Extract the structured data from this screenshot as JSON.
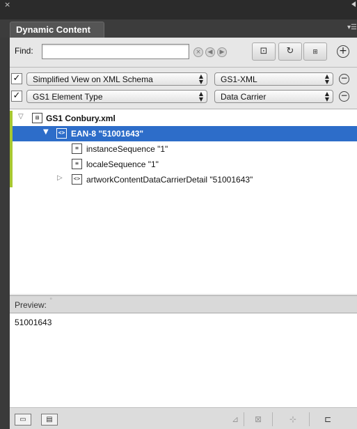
{
  "window": {
    "close_glyph": "×"
  },
  "tab": {
    "title": "Dynamic Content"
  },
  "find": {
    "label": "Find:",
    "value": ""
  },
  "filters": [
    {
      "checked": true,
      "left_select": "Simplified View on XML Schema",
      "right_select": "GS1-XML"
    },
    {
      "checked": true,
      "left_select": "GS1 Element Type",
      "right_select": "Data Carrier"
    }
  ],
  "tree": {
    "root": "GS1 Conbury.xml",
    "selected": "EAN-8  \"51001643\"",
    "children": [
      "instanceSequence  \"1\"",
      "localeSequence  \"1\""
    ],
    "collapsed": "artworkContentDataCarrierDetail  \"51001643\""
  },
  "preview": {
    "label": "Preview:",
    "value": "51001643"
  },
  "colors": {
    "selection": "#2d6dc9",
    "marker": "#a8c830"
  }
}
